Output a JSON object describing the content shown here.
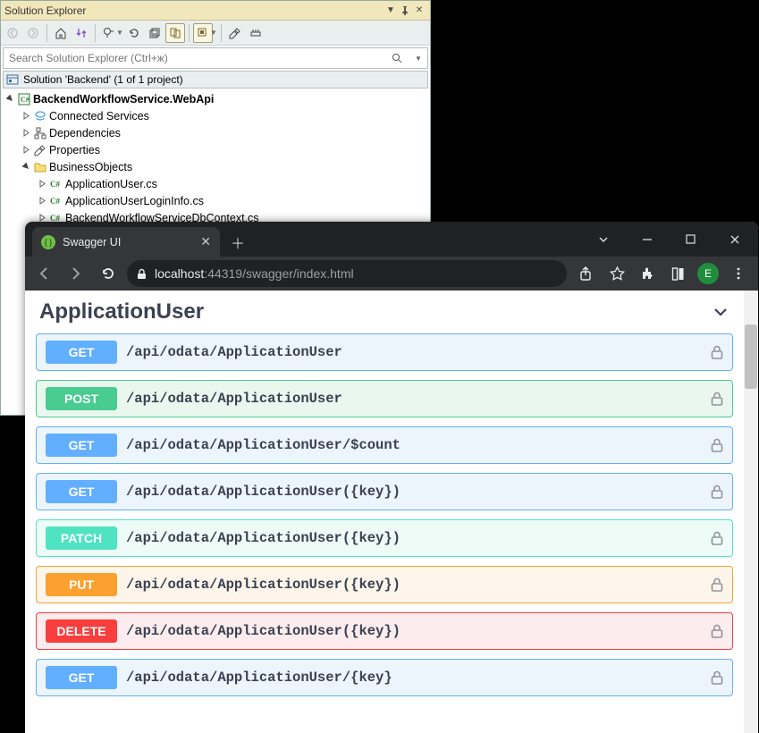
{
  "vs": {
    "title": "Solution Explorer",
    "search_placeholder": "Search Solution Explorer (Ctrl+ж)",
    "solution_line": "Solution 'Backend' (1 of 1 project)",
    "project": "BackendWorkflowService.WebApi",
    "nodes": {
      "connected": "Connected Services",
      "deps": "Dependencies",
      "props": "Properties",
      "bobj": "BusinessObjects",
      "file1": "ApplicationUser.cs",
      "file2": "ApplicationUserLoginInfo.cs",
      "file3": "BackendWorkflowServiceDbContext.cs"
    }
  },
  "browser": {
    "tab_title": "Swagger UI",
    "url_host": "localhost",
    "url_port": ":44319",
    "url_path": "/swagger/index.html",
    "avatar": "E"
  },
  "swagger": {
    "section": "ApplicationUser",
    "ops": [
      {
        "method": "GET",
        "cls": "op-get",
        "path": "/api/odata/ApplicationUser"
      },
      {
        "method": "POST",
        "cls": "op-post",
        "path": "/api/odata/ApplicationUser"
      },
      {
        "method": "GET",
        "cls": "op-get",
        "path": "/api/odata/ApplicationUser/$count"
      },
      {
        "method": "GET",
        "cls": "op-get",
        "path": "/api/odata/ApplicationUser({key})"
      },
      {
        "method": "PATCH",
        "cls": "op-patch",
        "path": "/api/odata/ApplicationUser({key})"
      },
      {
        "method": "PUT",
        "cls": "op-put",
        "path": "/api/odata/ApplicationUser({key})"
      },
      {
        "method": "DELETE",
        "cls": "op-delete",
        "path": "/api/odata/ApplicationUser({key})"
      },
      {
        "method": "GET",
        "cls": "op-get",
        "path": "/api/odata/ApplicationUser/{key}"
      }
    ]
  }
}
